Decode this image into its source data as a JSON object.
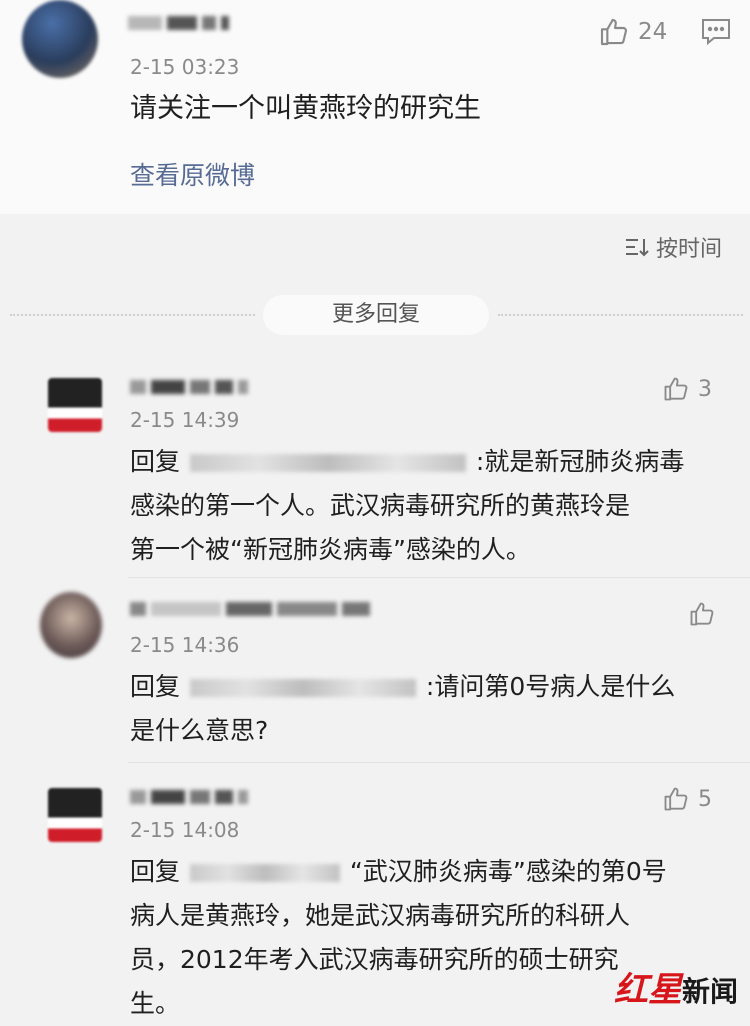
{
  "post": {
    "time": "2-15 03:23",
    "like_count": "24",
    "text": "请关注一个叫黄燕玲的研究生",
    "view_original": "查看原微博"
  },
  "sort_label": "按时间",
  "more_replies": "更多回复",
  "replies": [
    {
      "time": "2-15 14:39",
      "like_count": "3",
      "reply_prefix": "回复",
      "line1": ":就是新冠肺炎病毒",
      "line2": "感染的第一个人。武汉病毒研究所的黄燕玲是",
      "line3": "第一个被“新冠肺炎病毒”感染的人。"
    },
    {
      "time": "2-15 14:36",
      "like_count": "",
      "reply_prefix": "回复",
      "line1": ":请问第0号病人是什么",
      "line2": "是什么意思?"
    },
    {
      "time": "2-15 14:08",
      "like_count": "5",
      "reply_prefix": "回复",
      "line1": "“武汉肺炎病毒”感染的第0号",
      "line2": "病人是黄燕玲，她是武汉病毒研究所的科研人",
      "line3": "员，2012年考入武汉病毒研究所的硕士研究",
      "line4": "生。"
    }
  ],
  "watermark": {
    "red_part": "红星",
    "dark_part": "新闻"
  },
  "colors": {
    "link": "#576b95",
    "watermark_red": "#d7161b"
  }
}
